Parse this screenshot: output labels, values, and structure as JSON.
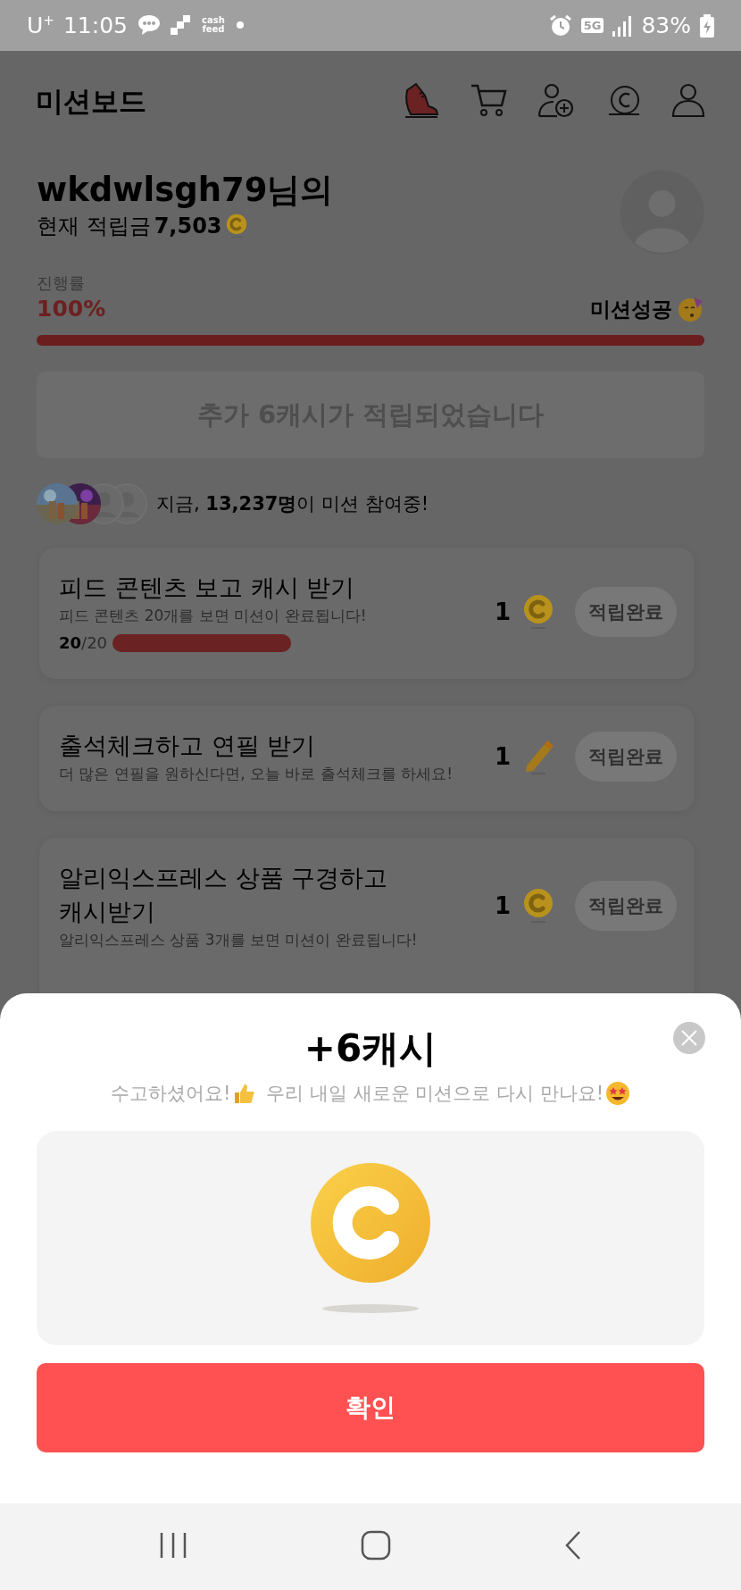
{
  "status_bar": {
    "carrier": "U$^{+}$",
    "time": "11:05",
    "app_logo": "cash feed",
    "network": "5G",
    "battery": "83%"
  },
  "header": {
    "logo": "미션보드"
  },
  "user": {
    "greeting": "wkdwlsgh79님의",
    "balance_label": "현재 적립금",
    "balance": "7,503"
  },
  "progress": {
    "label": "진행률",
    "percent": "100%",
    "level": 1,
    "status": "미션성공"
  },
  "banner": "추가 6캐시가 적립되었습니다",
  "participants": {
    "avatars": [
      {
        "kind": "picture"
      },
      {
        "kind": "picture"
      },
      {
        "kind": "placeholder"
      },
      {
        "kind": "placeholder"
      }
    ],
    "text": "지금, **13,237명**이 미션 참여중!"
  },
  "missions": [
    {
      "title": "피드 콘텐츠 보고 캐시 받기",
      "description": "피드 콘텐츠 20개를 보면 미션이 완료됩니다!",
      "progress": "**20**/20",
      "level": 1,
      "reward": "1",
      "kind": "coin",
      "button": "적립완료",
      "disabled": true
    },
    {
      "title": "출석체크하고 연필 받기",
      "description": "더 많은 연필을 원하신다면, 오늘 바로 출석체크를 하세요!",
      "reward": "1",
      "kind": "pencil",
      "button": "적립완료",
      "disabled": true
    },
    {
      "title": "알리익스프레스 상품 구경하고 캐시받기",
      "description": "알리익스프레스 상품 3개를 보면 미션이 완료됩니다!",
      "reward": "1",
      "kind": "coin",
      "button": "적립완료",
      "disabled": true
    }
  ],
  "sheet": {
    "title": "+6캐시",
    "message": [
      {
        "text": "수고하셨어요!",
        "kind": "thumbs_up"
      },
      {
        "text": "우리 내일 새로운 미션으로 다시 만나요!",
        "kind": "star_eyes"
      }
    ],
    "confirm": "확인"
  }
}
